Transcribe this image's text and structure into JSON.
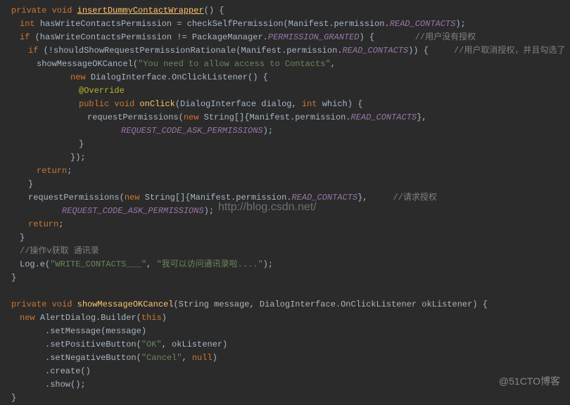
{
  "code": {
    "l1a": "private void ",
    "l1b": "insertDummyContactWrapper",
    "l1c": "() {",
    "l2a": "int ",
    "l2b": "hasWriteContactsPermission = checkSelfPermission(Manifest.permission.",
    "l2c": "READ_CONTACTS",
    "l2d": ");",
    "l3a": "if ",
    "l3b": "(hasWriteContactsPermission != PackageManager.",
    "l3c": "PERMISSION_GRANTED",
    "l3d": ") {",
    "l3e": "        //用户没有授权",
    "l4a": "if ",
    "l4b": "(!shouldShowRequestPermissionRationale(Manifest.permission.",
    "l4c": "READ_CONTACTS",
    "l4d": ")) {",
    "l4e": "     //用户取消授权，并且勾选了 ‘不再提示’。",
    "l5a": "showMessageOKCancel(",
    "l5b": "\"You need to allow access to Contacts\"",
    "l5c": ",",
    "l6a": "new ",
    "l6b": "DialogInterface.OnClickListener() {",
    "l7": "@Override",
    "l8a": "public void ",
    "l8b": "onClick",
    "l8c": "(DialogInterface dialog, ",
    "l8d": "int ",
    "l8e": "which) {",
    "l9a": "requestPermissions(",
    "l9b": "new ",
    "l9c": "String[]{Manifest.permission.",
    "l9d": "READ_CONTACTS",
    "l9e": "},",
    "l10a": "REQUEST_CODE_ASK_PERMISSIONS",
    "l10b": ");",
    "l11": "}",
    "l12": "});",
    "l13a": "return",
    "l13b": ";",
    "l14": "}",
    "l15a": "requestPermissions(",
    "l15b": "new ",
    "l15c": "String[]{Manifest.permission.",
    "l15d": "READ_CONTACTS",
    "l15e": "},",
    "l15f": "     //请求授权",
    "l16a": "REQUEST_CODE_ASK_PERMISSIONS",
    "l16b": ");",
    "l17a": "return",
    "l17b": ";",
    "l18": "}",
    "l19": "//操作v获取 通讯录",
    "l20a": "Log.e(",
    "l20b": "\"WRITE_CONTACTS___\"",
    "l20c": ", ",
    "l20d": "\"我可以访问通讯录啦....\"",
    "l20e": ");",
    "l21": "}",
    "l22": "",
    "l23a": "private void ",
    "l23b": "showMessageOKCancel",
    "l23c": "(String message, DialogInterface.OnClickListener okListener) {",
    "l24a": "new ",
    "l24b": "AlertDialog.Builder(",
    "l24c": "this",
    "l24d": ")",
    "l25a": ".setMessage(message)",
    "l26a": ".setPositiveButton(",
    "l26b": "\"OK\"",
    "l26c": ", okListener)",
    "l27a": ".setNegativeButton(",
    "l27b": "\"Cancel\"",
    "l27c": ", ",
    "l27d": "null",
    "l27e": ")",
    "l28": ".create()",
    "l29": ".show();",
    "l30": "}"
  },
  "watermark_url": "http://blog.csdn.net/",
  "watermark_site": "@51CTO博客"
}
